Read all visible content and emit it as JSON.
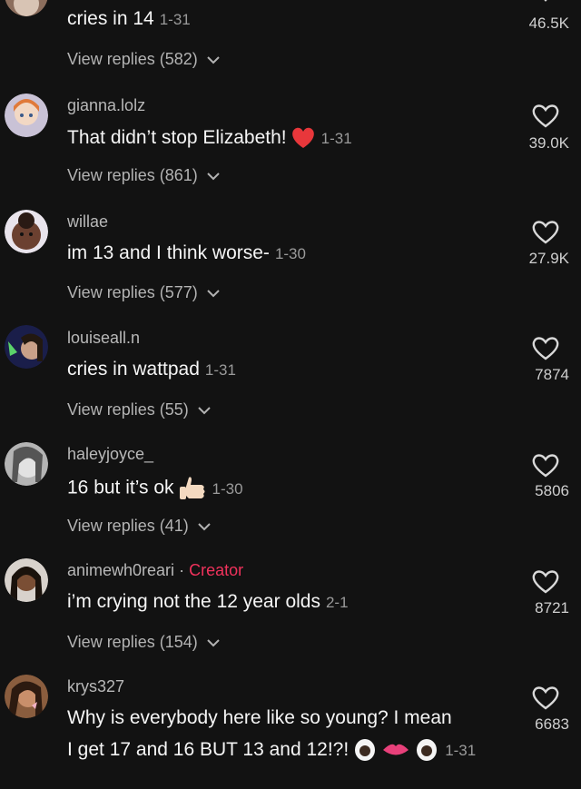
{
  "comments": [
    {
      "username": "",
      "text": "cries in 14",
      "date": "1-31",
      "replies": "View replies (582)",
      "likes": "46.5K"
    },
    {
      "username": "gianna.lolz",
      "text": "That didn’t stop Elizabeth!",
      "emoji": "red-heart-emoji",
      "date": "1-31",
      "replies": "View replies (861)",
      "likes": "39.0K"
    },
    {
      "username": "willae",
      "text": "im 13 and I think worse-",
      "date": "1-30",
      "replies": "View replies (577)",
      "likes": "27.9K"
    },
    {
      "username": "louiseall.n",
      "text": "cries in wattpad",
      "date": "1-31",
      "replies": "View replies (55)",
      "likes": "7874"
    },
    {
      "username": "haleyjoyce_",
      "text": "16 but it’s ok",
      "emoji": "thumbs-up-emoji",
      "date": "1-30",
      "replies": "View replies (41)",
      "likes": "5806"
    },
    {
      "username": "animewh0reari",
      "creator_sep": "·",
      "creator_label": "Creator",
      "text": "i’m crying not the 12 year olds",
      "date": "2-1",
      "replies": "View replies (154)",
      "likes": "8721"
    },
    {
      "username": "krys327",
      "text": "Why is everybody here like so young? I mean",
      "text2": "I get 17 and 16 BUT 13 and 12!?!",
      "emoji": "eyes-lips-emoji",
      "date": "1-31",
      "likes": "6683"
    }
  ],
  "colors": {
    "background": "#121212",
    "creator_accent": "#f1325c",
    "heart_emoji": "#e8373b"
  }
}
